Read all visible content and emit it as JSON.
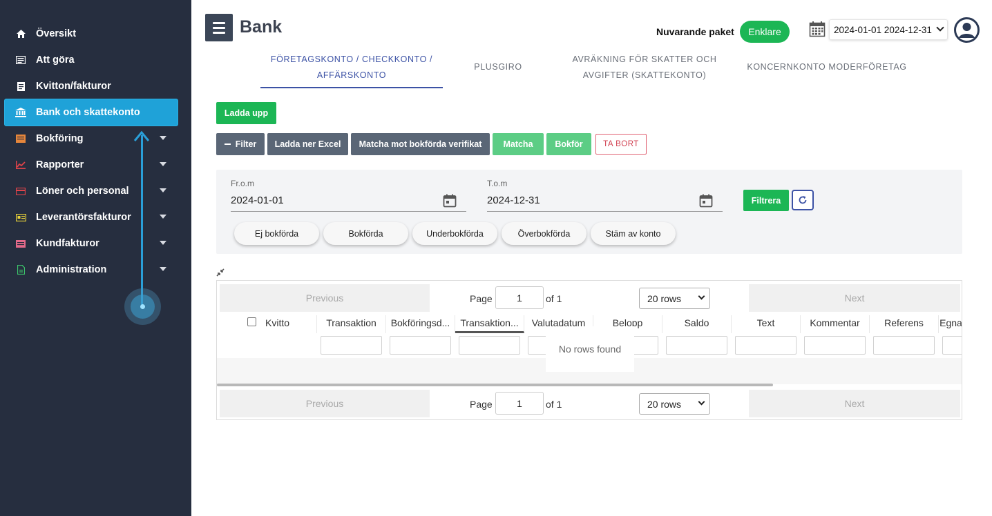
{
  "sidebar": {
    "items": [
      {
        "label": "Översikt",
        "icon": "home-icon",
        "color": "#ffffff"
      },
      {
        "label": "Att göra",
        "icon": "list-icon",
        "color": "#ffffff"
      },
      {
        "label": "Kvitton/fakturor",
        "icon": "receipt-icon",
        "color": "#ffffff"
      },
      {
        "label": "Bank och skattekonto",
        "icon": "bank-icon",
        "color": "#ffffff",
        "active": true
      },
      {
        "label": "Bokföring",
        "icon": "ledger-icon",
        "color": "#e6863b",
        "expandable": true
      },
      {
        "label": "Rapporter",
        "icon": "chart-icon",
        "color": "#e0434a",
        "expandable": true
      },
      {
        "label": "Löner och personal",
        "icon": "card-icon",
        "color": "#e0434a",
        "expandable": true
      },
      {
        "label": "Leverantörsfakturor",
        "icon": "invoice-icon",
        "color": "#e8d23a",
        "expandable": true
      },
      {
        "label": "Kundfakturor",
        "icon": "customer-invoice-icon",
        "color": "#e46a8a",
        "expandable": true
      },
      {
        "label": "Administration",
        "icon": "document-icon",
        "color": "#3cc46a",
        "expandable": true
      }
    ]
  },
  "header": {
    "title": "Bank",
    "package_label": "Nuvarande paket",
    "package_value": "Enklare",
    "date_range": "2024-01-01 2024-12-31"
  },
  "tabs": [
    {
      "line1": "FÖRETAGSKONTO / CHECKKONTO /",
      "line2": "AFFÄRSKONTO",
      "active": true
    },
    {
      "line1": "PLUSGIRO",
      "line2": ""
    },
    {
      "line1": "AVRÄKNING FÖR SKATTER OCH",
      "line2": "AVGIFTER (SKATTEKONTO)"
    },
    {
      "line1": "KONCERNKONTO MODERFÖRETAG",
      "line2": ""
    }
  ],
  "actions": {
    "upload": "Ladda upp",
    "filter": "Filter",
    "download_excel": "Ladda ner Excel",
    "match_verif": "Matcha mot bokförda verifikat",
    "match": "Matcha",
    "book": "Bokför",
    "delete": "TA BORT"
  },
  "filters": {
    "from_label": "Fr.o.m",
    "from_value": "2024-01-01",
    "to_label": "T.o.m",
    "to_value": "2024-12-31",
    "apply": "Filtrera",
    "pills": [
      "Ej bokförda",
      "Bokförda",
      "Underbokförda",
      "Överbokförda",
      "Stäm av konto"
    ]
  },
  "table": {
    "previous": "Previous",
    "next": "Next",
    "page_label": "Page",
    "page_value": "1",
    "of_label": "of 1",
    "rows_value": "20 rows",
    "columns": [
      "Kvitto",
      "Transaktion",
      "Bokföringsd...",
      "Transaktion...",
      "Valutadatum",
      "Belopp",
      "Saldo",
      "Text",
      "Kommentar",
      "Referens",
      "Egna"
    ],
    "empty_message": "No rows found"
  },
  "colors": {
    "sidebar_bg": "#262e3f",
    "active_item": "#1fa2d8",
    "primary_green": "#1cb655",
    "slate": "#5a6676",
    "tab_active": "#3c52a5"
  }
}
